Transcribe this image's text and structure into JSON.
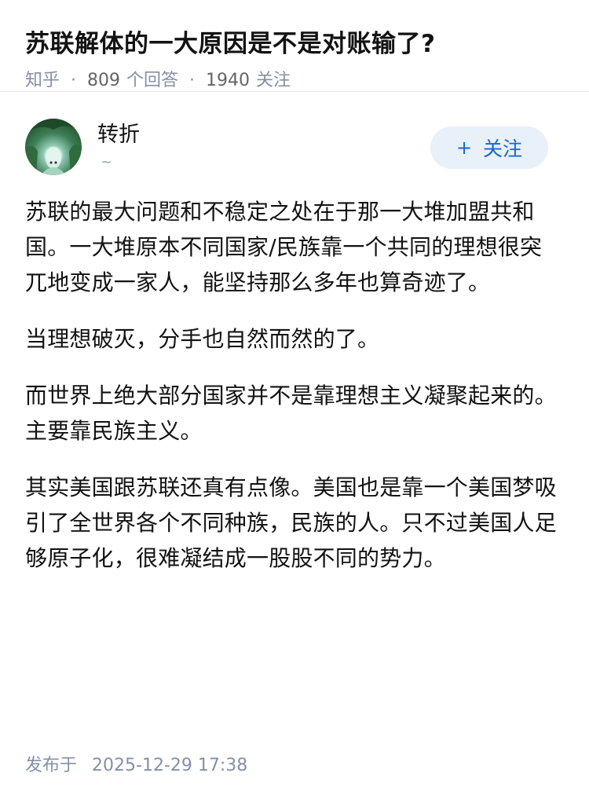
{
  "question": {
    "title": "苏联解体的一大原因是不是对账输了?",
    "source": "知乎",
    "answers_count": "809",
    "answers_label": "个回答",
    "followers_count": "1940",
    "followers_label": "关注"
  },
  "author": {
    "name": "转折",
    "bio": "~",
    "follow_label": "关注",
    "follow_icon": "plus-icon"
  },
  "answer": {
    "paragraphs": [
      "苏联的最大问题和不稳定之处在于那一大堆加盟共和国。一大堆原本不同国家/民族靠一个共同的理想很突兀地变成一家人，能坚持那么多年也算奇迹了。",
      "当理想破灭，分手也自然而然的了。",
      "而世界上绝大部分国家并不是靠理想主义凝聚起来的。主要靠民族主义。",
      "其实美国跟苏联还真有点像。美国也是靠一个美国梦吸引了全世界各个不同种族，民族的人。只不过美国人足够原子化，很难凝结成一股股不同的势力。"
    ]
  },
  "footer": {
    "published_label": "发布于",
    "published_time": "2025-12-29 17:38"
  }
}
